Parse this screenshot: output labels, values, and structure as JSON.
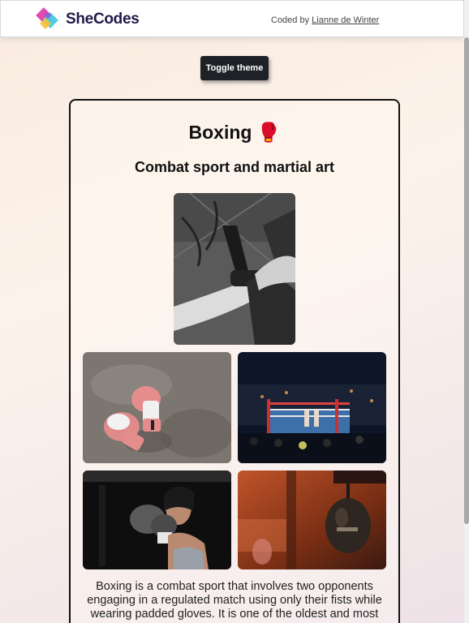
{
  "header": {
    "brand": "SheCodes",
    "credit_prefix": "Coded by",
    "credit_author": "Lianne de Winter"
  },
  "toolbar": {
    "toggle_label": "Toggle theme"
  },
  "main": {
    "title": "Boxing 🥊",
    "subtitle": "Combat sport and martial art",
    "description": "Boxing is a combat sport that involves two opponents engaging in a regulated match using only their fists while wearing padded gloves. It is one of the oldest and most"
  },
  "colors": {
    "button_bg": "#1e2126",
    "card_border": "#111111",
    "brand_text": "#1f1a4a"
  }
}
